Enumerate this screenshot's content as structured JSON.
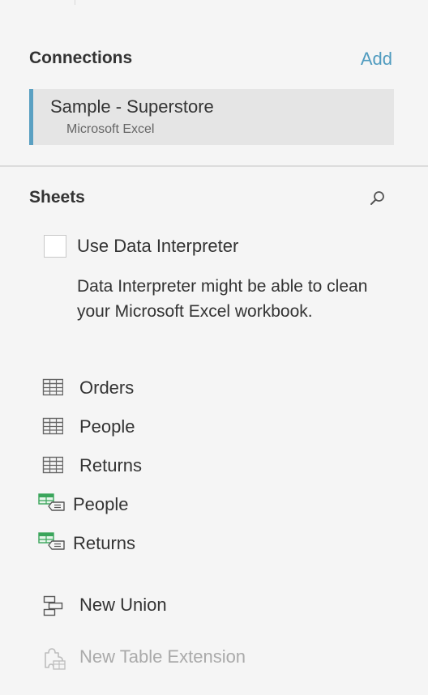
{
  "connections": {
    "title": "Connections",
    "add_label": "Add",
    "items": [
      {
        "name": "Sample - Superstore",
        "type": "Microsoft Excel"
      }
    ]
  },
  "sheets": {
    "title": "Sheets",
    "data_interpreter": {
      "label": "Use Data Interpreter",
      "checked": false,
      "description": "Data Interpreter might be able to clean your Microsoft Excel workbook."
    },
    "items": [
      {
        "label": "Orders",
        "icon": "table-icon"
      },
      {
        "label": "People",
        "icon": "table-icon"
      },
      {
        "label": "Returns",
        "icon": "table-icon"
      },
      {
        "label": "People",
        "icon": "named-range-icon"
      },
      {
        "label": "Returns",
        "icon": "named-range-icon"
      }
    ],
    "actions": [
      {
        "label": "New Union",
        "icon": "union-icon",
        "enabled": true
      },
      {
        "label": "New Table Extension",
        "icon": "table-extension-icon",
        "enabled": false
      }
    ]
  },
  "colors": {
    "accent": "#4f9bbf",
    "card_border": "#5aa0c2",
    "named_range_green": "#3aa55b"
  }
}
